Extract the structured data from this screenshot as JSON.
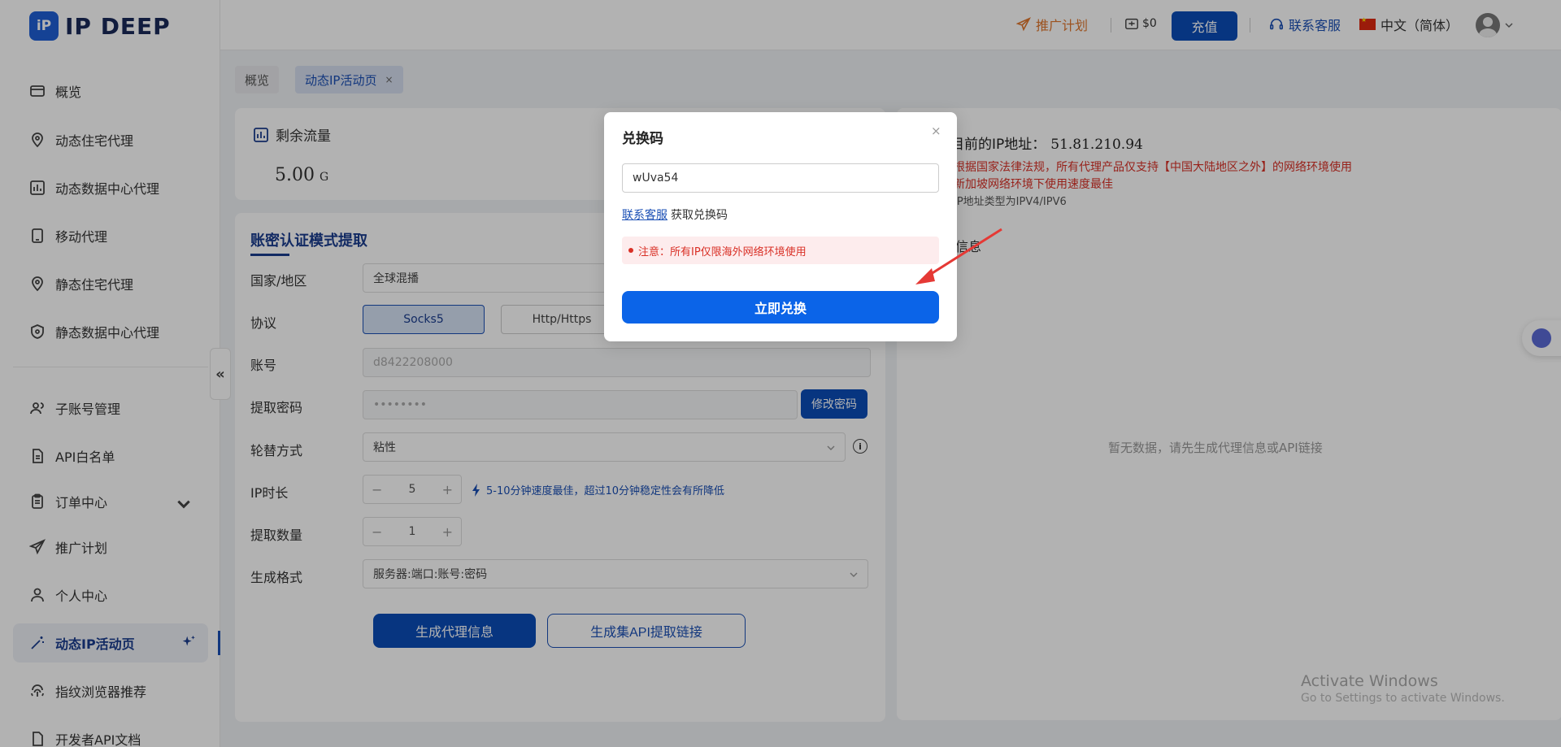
{
  "brand": {
    "logo_mark": "iP",
    "name": "IP DEEP"
  },
  "sidebar": {
    "items": [
      {
        "label": "概览",
        "icon": "overview-icon"
      },
      {
        "label": "动态住宅代理",
        "icon": "location-pin-icon"
      },
      {
        "label": "动态数据中心代理",
        "icon": "bar-chart-icon"
      },
      {
        "label": "移动代理",
        "icon": "mobile-icon"
      },
      {
        "label": "静态住宅代理",
        "icon": "location-pin-icon"
      },
      {
        "label": "静态数据中心代理",
        "icon": "shield-icon"
      },
      {
        "label": "子账号管理",
        "icon": "users-icon"
      },
      {
        "label": "API白名单",
        "icon": "document-icon"
      },
      {
        "label": "订单中心",
        "icon": "clipboard-icon"
      },
      {
        "label": "推广计划",
        "icon": "send-icon"
      },
      {
        "label": "个人中心",
        "icon": "user-icon"
      },
      {
        "label": "动态IP活动页",
        "icon": "magic-wand-icon"
      },
      {
        "label": "指纹浏览器推荐",
        "icon": "fingerprint-icon"
      },
      {
        "label": "开发者API文档",
        "icon": "file-icon"
      }
    ],
    "collapse_glyph": "«"
  },
  "header": {
    "promo": "推广计划",
    "balance": "$0",
    "recharge": "充值",
    "support": "联系客服",
    "language": "中文（简体）"
  },
  "tabs": {
    "overview": "概览",
    "active": "动态IP活动页",
    "close": "×"
  },
  "flow_card": {
    "title": "剩余流量",
    "value": "5.00",
    "unit": "G"
  },
  "extract": {
    "title": "账密认证模式提取",
    "fields": {
      "country_label": "国家/地区",
      "country_value": "全球混播",
      "protocol_label": "协议",
      "protocol_socks": "Socks5",
      "protocol_http": "Http/Https",
      "account_label": "账号",
      "account_value": "d8422208000",
      "password_label": "提取密码",
      "password_value": "••••••••",
      "change_password": "修改密码",
      "rotation_label": "轮替方式",
      "rotation_value": "粘性",
      "duration_label": "IP时长",
      "duration_value": "5",
      "duration_hint": "5-10分钟速度最佳，超过10分钟稳定性会有所降低",
      "quantity_label": "提取数量",
      "quantity_value": "1",
      "format_label": "生成格式",
      "format_value": "服务器:端口:账号:密码",
      "minus": "−",
      "plus": "+",
      "info": "i"
    },
    "generate_button": "生成代理信息",
    "api_button": "生成集API提取链接"
  },
  "ip_panel": {
    "title": "目前的IP地址：",
    "ip": "51.81.210.94",
    "note1": "根据国家法律法规，所有代理产品仅支持【中国大陆地区之外】的网络环境使用",
    "note2": "新加坡网络环境下使用速度最佳",
    "note3": "IP地址类型为IPV4/IPV6",
    "section": "信息",
    "empty": "暂无数据，请先生成代理信息或API链接"
  },
  "watermark": {
    "line1": "Activate Windows",
    "line2": "Go to Settings to activate Windows."
  },
  "modal": {
    "title": "兑换码",
    "close": "×",
    "code_value": "wUva54",
    "support_link": "联系客服",
    "get_code": "获取兑换码",
    "notice": "注意：所有IP仅限海外网络环境使用",
    "submit": "立即兑换"
  },
  "colors": {
    "primary": "#0b4db8",
    "modal_button": "#0b64e8",
    "warning": "#d93026",
    "promo": "#e0772e"
  }
}
